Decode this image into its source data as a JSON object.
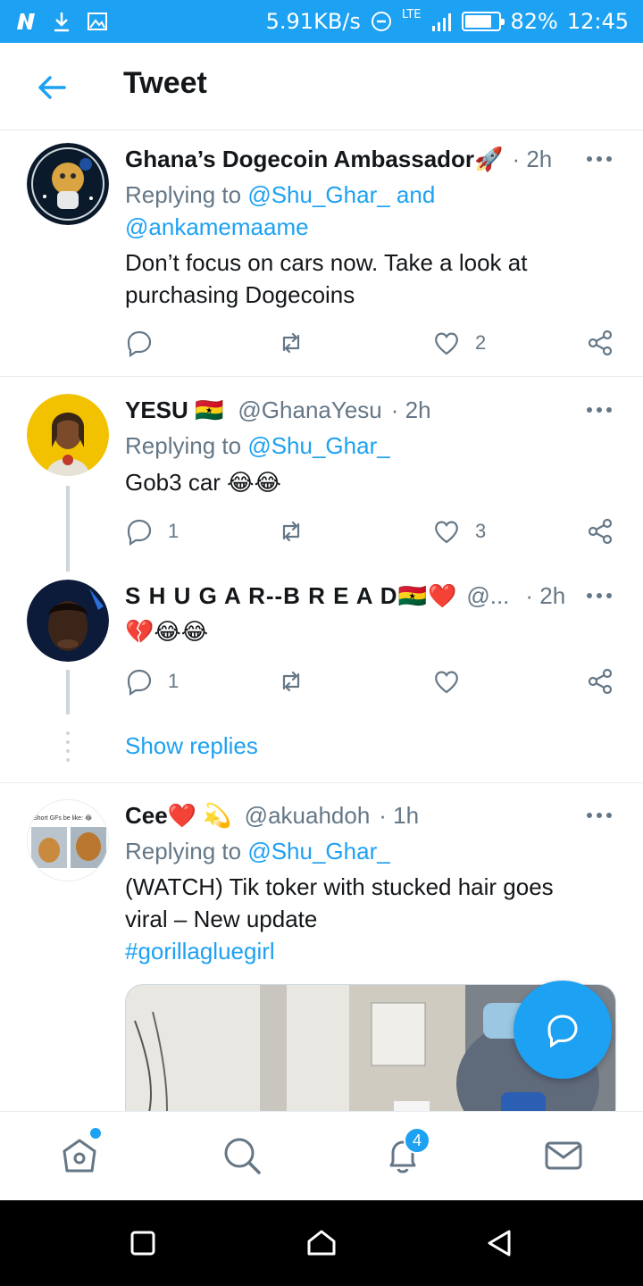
{
  "status_bar": {
    "speed": "5.91KB/s",
    "network": "LTE",
    "battery": "82%",
    "battery_level": 0.82,
    "time": "12:45"
  },
  "header": {
    "title": "Tweet"
  },
  "tweets": [
    {
      "name": "Ghana’s Dogecoin Ambassador🚀",
      "handle": "",
      "time": "· 2h",
      "replying_prefix": "Replying to ",
      "replying_line1": "@Shu_Ghar_ and",
      "replying_line2": "@ankamemaame",
      "text_line1": "Don’t focus on cars now. Take a look at",
      "text_line2": "purchasing Dogecoins",
      "replies": "",
      "likes": "2"
    },
    {
      "name": "YESU 🇬🇭",
      "handle": "@GhanaYesu",
      "time": "· 2h",
      "replying_prefix": "Replying to ",
      "replying_line1": "@Shu_Ghar_",
      "text_line1": "Gob3 car 😂😂",
      "replies": "1",
      "likes": "3"
    },
    {
      "name": "S H U G A R--B R E A D🇬🇭❤️",
      "handle": "@...",
      "time": "· 2h",
      "text_line1": "💔😂😂",
      "replies": "1",
      "likes": ""
    },
    {
      "name": "Cee❤️ 💫",
      "handle": "@akuahdoh",
      "time": "· 1h",
      "replying_prefix": "Replying to ",
      "replying_line1": "@Shu_Ghar_",
      "text_line1": "(WATCH) Tik toker with stucked hair goes",
      "text_line2": "viral – New update",
      "hashtag": "#gorillagluegirl",
      "avatar_caption": "Short GFs be like: 😂"
    }
  ],
  "show_replies": "Show replies",
  "bottom_nav": {
    "notifications_badge": "4"
  },
  "colors": {
    "accent": "#1da1f2",
    "muted": "#657786",
    "text": "#14171a",
    "border": "#e6ecf0"
  }
}
